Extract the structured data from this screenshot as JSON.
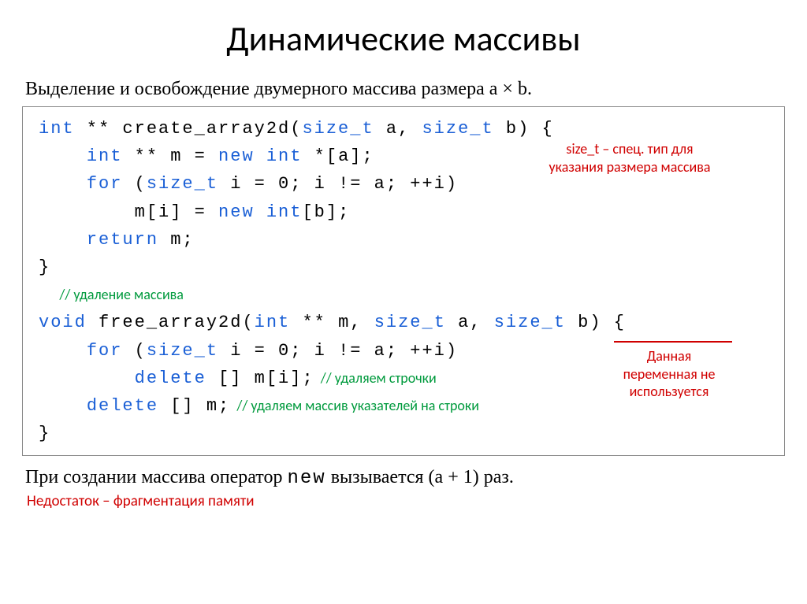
{
  "title": "Динамические массивы",
  "subtitle_pre": "Выделение и освобождение двумерного массива размера ",
  "subtitle_expr": "a × b",
  "subtitle_post": ".",
  "code": {
    "l1_kw1": "int",
    "l1_txt1": " ** create_array2d(",
    "l1_kw2": "size_t",
    "l1_txt2": " a, ",
    "l1_kw3": "size_t",
    "l1_txt3": " b) {",
    "l2_ind": "    ",
    "l2_kw1": "int",
    "l2_txt1": " ** m = ",
    "l2_kw2": "new",
    "l2_txt2": " ",
    "l2_kw3": "int",
    "l2_txt3": " *[a];",
    "l3_ind": "    ",
    "l3_kw1": "for",
    "l3_txt1": " (",
    "l3_kw2": "size_t",
    "l3_txt2": " i = 0; i != a; ++i)",
    "l4_ind": "        ",
    "l4_txt1": "m[i] = ",
    "l4_kw1": "new",
    "l4_txt2": " ",
    "l4_kw2": "int",
    "l4_txt3": "[b];",
    "l5_ind": "    ",
    "l5_kw1": "return",
    "l5_txt1": " m;",
    "l6_txt": "}",
    "l7_ann": "// удаление массива",
    "l8_kw1": "void",
    "l8_txt1": " free_array2d(",
    "l8_kw2": "int",
    "l8_txt2": " ** m, ",
    "l8_kw3": "size_t",
    "l8_txt3": " a, ",
    "l8_kw4": "size_t",
    "l8_txt4": " b) {",
    "l9_ind": "    ",
    "l9_kw1": "for",
    "l9_txt1": " (",
    "l9_kw2": "size_t",
    "l9_txt2": " i = 0; i != a; ++i)",
    "l10_ind": "        ",
    "l10_kw1": "delete",
    "l10_txt1": " [] m[i];",
    "l10_ann": "  // удаляем строчки",
    "l11_ind": "    ",
    "l11_kw1": "delete",
    "l11_txt1": " [] m;",
    "l11_ann": "  // удаляем массив указателей на строки",
    "l12_txt": "}"
  },
  "ann_size_t_l1": "size_t – спец. тип для",
  "ann_size_t_l2": "указания размера массива",
  "ann_unused_l1": "Данная",
  "ann_unused_l2": "переменная не",
  "ann_unused_l3": "используется",
  "bottom_pre": "При создании массива оператор ",
  "bottom_kw": "new",
  "bottom_mid": " вызывается ",
  "bottom_expr": "(a + 1)",
  "bottom_post": " раз.",
  "bottom_red": "Недостаток – фрагментация памяти"
}
